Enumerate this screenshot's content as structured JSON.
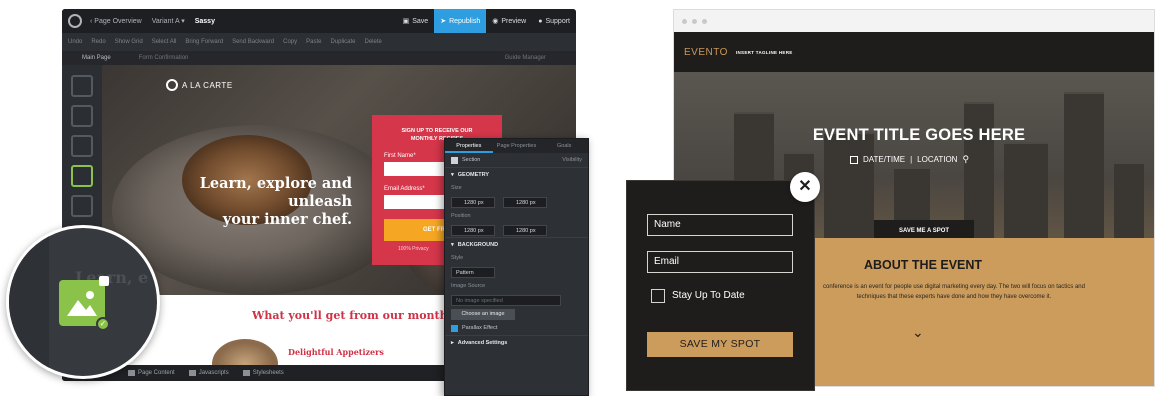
{
  "builder": {
    "topbar": {
      "crumbs": [
        "‹ Page Overview",
        "Variant A ▾",
        "Sassy"
      ],
      "save": "Save",
      "republish": "Republish",
      "preview": "Preview",
      "support": "Support"
    },
    "toolbar": [
      "Undo",
      "Redo",
      "Show Grid",
      "Select All",
      "Bring Forward",
      "Send Backward",
      "Copy",
      "Paste",
      "Duplicate",
      "Delete"
    ],
    "tabs": {
      "main": "Main Page",
      "form": "Form Confirmation",
      "right": "Guide Manager"
    },
    "bottombar": {
      "page_content": "Page Content",
      "javascripts": "Javascripts",
      "stylesheets": "Stylesheets"
    },
    "canvas": {
      "brand": "A LA CARTE",
      "headline_1": "Learn, explore and unleash",
      "headline_2": "your inner chef.",
      "signup_title_1": "SIGN UP TO RECEIVE OUR",
      "signup_title_2": "MONTHLY RECIPES",
      "first_name_label": "First Name*",
      "email_label": "Email Address*",
      "get_free": "GET FREE",
      "signup_note": "100% Privacy",
      "recipes_heading": "What you'll get from our monthly recipes",
      "appetizers": "Delightful Appetizers"
    },
    "magnifier_ghost_text": "Learn, e"
  },
  "properties": {
    "tabs": [
      "Properties",
      "Page Properties",
      "Goals"
    ],
    "section_label": "Section",
    "visibility_label": "Visibility",
    "geometry": "GEOMETRY",
    "size_label": "Size",
    "size_w": "1280 px",
    "size_h": "1280 px",
    "position_label": "Position",
    "pos_x": "1280 px",
    "pos_y": "1280 px",
    "background": "BACKGROUND",
    "style_label": "Style",
    "style_value": "Pattern",
    "image_source_label": "Image Source",
    "image_source_placeholder": "No image specified",
    "choose_image": "Choose an image",
    "parallax": "Parallax Effect",
    "advanced": "Advanced Settings"
  },
  "event": {
    "logo": "EVENTO",
    "tagline": "INSERT TAGLINE HERE",
    "title": "EVENT TITLE GOES HERE",
    "datetime": "DATE/TIME",
    "separator": "|",
    "location": "LOCATION",
    "save_spot_small": "SAVE ME A SPOT",
    "about_heading": "ABOUT THE EVENT",
    "about_text": "conference is an event for people use digital marketing every day. The two will focus on tactics and techniques that these experts have done and how they have overcome it."
  },
  "popup": {
    "name_placeholder": "Name",
    "email_placeholder": "Email",
    "checkbox_label": "Stay Up To Date",
    "submit": "SAVE MY SPOT"
  },
  "colors": {
    "builder_dark": "#26282c",
    "accent_blue": "#2f9ee0",
    "signup_red": "#d6364a",
    "image_tool_green": "#8bc34a",
    "event_dark": "#1f1c1c",
    "event_gold": "#cc9c5c"
  }
}
